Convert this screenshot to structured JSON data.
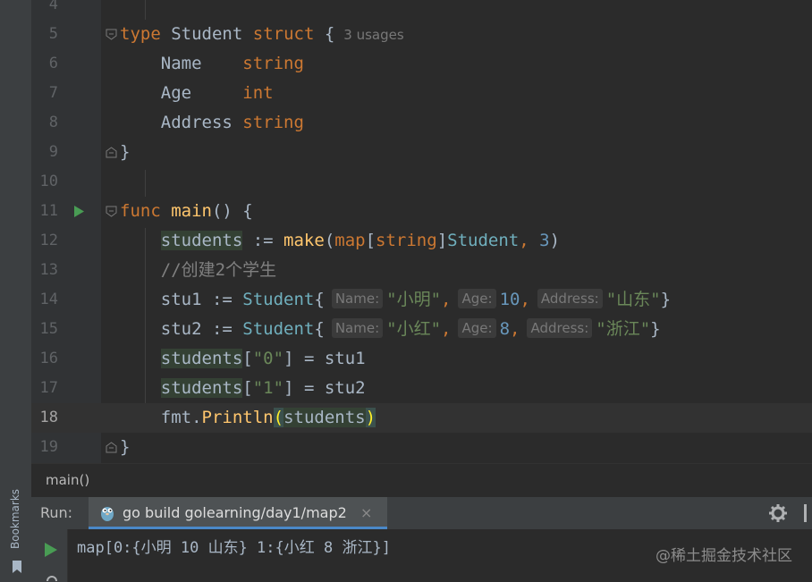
{
  "editor": {
    "lines": [
      {
        "num": "4"
      },
      {
        "num": "5",
        "kw1": "type",
        "name": "Student",
        "kw2": "struct",
        "brace": "{",
        "usages": "3 usages"
      },
      {
        "num": "6",
        "field": "Name",
        "ftype": "string"
      },
      {
        "num": "7",
        "field": "Age",
        "ftype": "int"
      },
      {
        "num": "8",
        "field": "Address",
        "ftype": "string"
      },
      {
        "num": "9",
        "text": "}"
      },
      {
        "num": "10"
      },
      {
        "num": "11",
        "kw": "func",
        "fn": "main",
        "rest": "() {"
      },
      {
        "num": "12",
        "var": "students",
        "op": " := ",
        "fn": "make",
        "p1": "(",
        "kw1": "map",
        "b1": "[",
        "kw2": "string",
        "b2": "]",
        "type": "Student",
        "comma": ", ",
        "n": "3",
        "p2": ")"
      },
      {
        "num": "13",
        "comment": "//创建2个学生"
      },
      {
        "num": "14",
        "var": "stu1",
        "op": " := ",
        "type": "Student",
        "brace": "{",
        "h1": "Name:",
        "v1": "\"小明\"",
        "c1": ",",
        "h2": "Age:",
        "v2": "10",
        "c2": ",",
        "h3": "Address:",
        "v3": "\"山东\"",
        "end": "}"
      },
      {
        "num": "15",
        "var": "stu2",
        "op": " := ",
        "type": "Student",
        "brace": "{",
        "h1": "Name:",
        "v1": "\"小红\"",
        "c1": ",",
        "h2": "Age:",
        "v2": "8",
        "c2": ",",
        "h3": "Address:",
        "v3": "\"浙江\"",
        "end": "}"
      },
      {
        "num": "16",
        "var": "students",
        "b1": "[",
        "key": "\"0\"",
        "b2": "]",
        "rest": " = stu1"
      },
      {
        "num": "17",
        "var": "students",
        "b1": "[",
        "key": "\"1\"",
        "b2": "]",
        "rest": " = stu2"
      },
      {
        "num": "18",
        "pkg": "fmt.",
        "fn": "Println",
        "p1": "(",
        "arg": "students",
        "p2": ")"
      },
      {
        "num": "19",
        "text": "}"
      }
    ]
  },
  "breadcrumb": "main()",
  "bookmarks_label": "Bookmarks",
  "run": {
    "label": "Run:",
    "tab_label": "go build golearning/day1/map2",
    "close": "×",
    "output": "map[0:{小明 10 山东} 1:{小红 8 浙江}]"
  },
  "watermark": "@稀土掘金技术社区",
  "icons": {
    "fold": "fold-icon",
    "run_gutter": "run-gutter-icon",
    "gear": "gear-icon",
    "rerun": "rerun-icon",
    "gopher": "gopher-icon",
    "bookmark": "bookmark-icon"
  },
  "colors": {
    "background": "#2b2b2b",
    "keyword": "#cc7832",
    "type": "#6fafbd",
    "function": "#ffc66d",
    "string": "#6a8759",
    "number": "#6897bb",
    "comment": "#808080",
    "run_green": "#499c54"
  }
}
